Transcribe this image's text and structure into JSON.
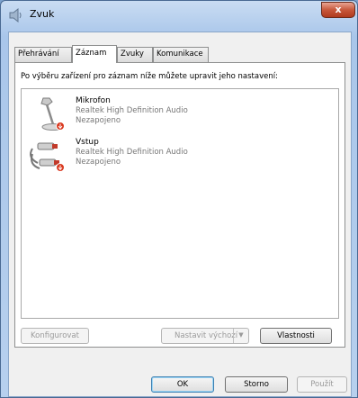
{
  "window": {
    "title": "Zvuk",
    "close_label": "x"
  },
  "tabs": [
    {
      "label": "Přehrávání",
      "active": false
    },
    {
      "label": "Záznam",
      "active": true
    },
    {
      "label": "Zvuky",
      "active": false
    },
    {
      "label": "Komunikace",
      "active": false
    }
  ],
  "panel": {
    "instruction": "Po výběru zařízení pro záznam níže můžete upravit jeho nastavení:"
  },
  "devices": [
    {
      "name": "Mikrofon",
      "driver": "Realtek High Definition Audio",
      "status": "Nezapojeno",
      "icon": "microphone-icon"
    },
    {
      "name": "Vstup",
      "driver": "Realtek High Definition Audio",
      "status": "Nezapojeno",
      "icon": "line-in-cable-icon"
    }
  ],
  "panel_buttons": {
    "configure": "Konfigurovat",
    "set_default": "Nastavit výchozí",
    "dropdown_arrow": "▼",
    "properties": "Vlastnosti"
  },
  "dialog_buttons": {
    "ok": "OK",
    "cancel": "Storno",
    "apply": "Použít"
  },
  "colors": {
    "accent": "#3c7fb1",
    "disabled_text": "#9a9a9a",
    "status_badge": "#d9381e"
  }
}
